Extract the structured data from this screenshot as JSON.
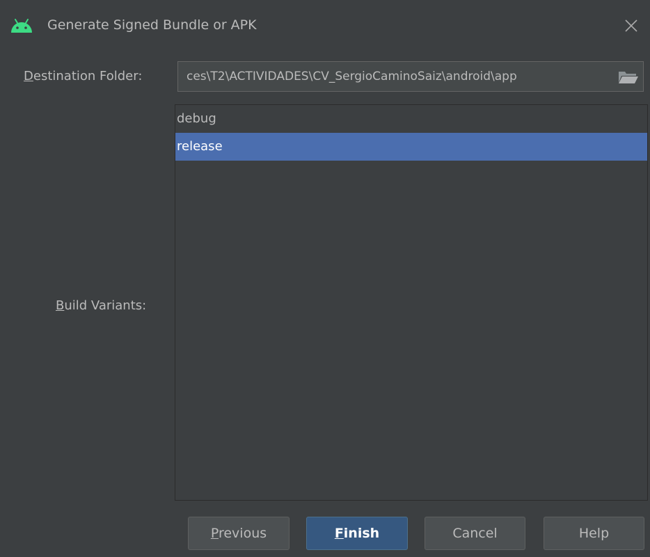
{
  "window": {
    "title": "Generate Signed Bundle or APK",
    "icon": "android-icon",
    "close_icon": "close-icon"
  },
  "form": {
    "destination_label": {
      "mnemonic": "D",
      "rest": "estination Folder:"
    },
    "destination_value": "ces\\T2\\ACTIVIDADES\\CV_SergioCaminoSaiz\\android\\app",
    "folder_icon": "folder-open-icon",
    "variants_label": {
      "mnemonic": "B",
      "rest": "uild Variants:"
    },
    "variants": [
      {
        "label": "debug",
        "selected": false
      },
      {
        "label": "release",
        "selected": true
      }
    ]
  },
  "buttons": {
    "previous": {
      "mnemonic": "P",
      "rest": "revious"
    },
    "finish": {
      "mnemonic": "F",
      "rest": "inish"
    },
    "cancel": "Cancel",
    "help": "Help"
  },
  "colors": {
    "background": "#3c3f41",
    "text": "#bbbbbb",
    "selection": "#4b6eaf",
    "default_button": "#365880",
    "android_green": "#3ddc84"
  }
}
